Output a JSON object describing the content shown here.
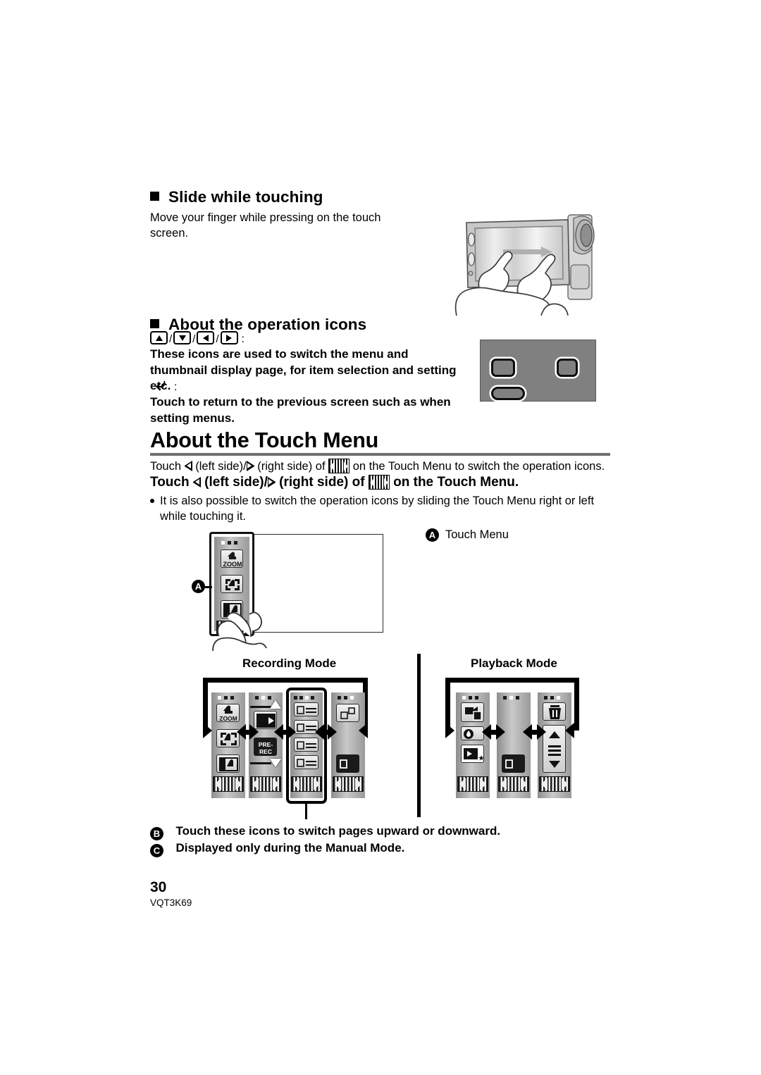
{
  "page": {
    "number": "30",
    "doc_code": "VQT3K69"
  },
  "sections": {
    "slide": {
      "heading": "Slide while touching",
      "body": "Move your finger while pressing on the touch screen."
    },
    "operation_icons": {
      "heading": "About the operation icons",
      "icon_list_colon": ":",
      "icons": [
        "triangle-up",
        "triangle-down",
        "triangle-left",
        "triangle-right"
      ],
      "separator": "/",
      "desc1": "These icons are used to switch the menu and thumbnail display page, for item selection and setting etc.",
      "return_colon": ":",
      "desc2": "Touch to return to the previous screen such as when setting menus."
    },
    "touch_menu": {
      "title": "About the Touch Menu",
      "line_a_part1": "Touch",
      "line_a_left": "(left side)/",
      "line_a_right": "(right side) of",
      "line_a_part2": "on the Touch Menu to switch the operation icons.",
      "line_b_part1": "Touch",
      "line_b_left": "(left side)/",
      "line_b_right": "(right side) of",
      "line_b_part2": "on the Touch Menu.",
      "bullet": "It is also possible to switch the operation icons by sliding the Touch Menu right or left while touching it."
    }
  },
  "callouts": {
    "a_letter": "A",
    "a_label": "Touch Menu",
    "b_letter": "B",
    "b_label": "Touch these icons to switch pages upward or downward.",
    "c_letter": "C",
    "c_label": "Displayed only during the Manual Mode."
  },
  "diagram": {
    "recording_mode_label": "Recording Mode",
    "playback_mode_label": "Playback Mode",
    "recording_panels": [
      {
        "dots": [
          0,
          0,
          0
        ],
        "active": 0,
        "tiles": [
          "zoom-icon",
          "touch-shutter-icon",
          "fade-icon"
        ]
      },
      {
        "dots": [
          0,
          0,
          0
        ],
        "active": 1,
        "tiles": [
          "backlight-icon",
          "pre-rec-icon"
        ]
      },
      {
        "dots": [
          0,
          0,
          0,
          0
        ],
        "active": 2,
        "tiles": [
          "menu-list-icon",
          "menu-list-icon",
          "menu-list-icon",
          "menu-list-icon"
        ]
      },
      {
        "dots": [
          0,
          0,
          0
        ],
        "active": 2,
        "tiles": [
          "window-icon",
          "lcd-off-icon"
        ]
      }
    ],
    "playback_panels": [
      {
        "dots": [
          0,
          0,
          0
        ],
        "active": 0,
        "tiles": [
          "video-copy-icon",
          "drop-icon",
          "slideshow-icon"
        ]
      },
      {
        "dots": [
          0,
          0,
          0
        ],
        "active": 1,
        "tiles": [
          "lcd-off-icon"
        ]
      },
      {
        "dots": [
          0,
          0,
          0
        ],
        "active": 2,
        "tiles": [
          "trash-icon",
          "scroll-updown-icon"
        ]
      }
    ],
    "zoom_label": "ZOOM",
    "prerec_label_1": "PRE-",
    "prerec_label_2": "REC"
  },
  "colors": {
    "rule": "#6e6e6e",
    "panel_grey": "#808080",
    "ink": "#000000"
  }
}
